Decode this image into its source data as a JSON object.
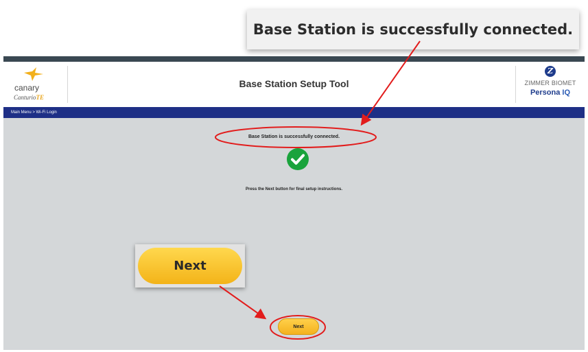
{
  "callout": {
    "text": "Base Station is successfully connected."
  },
  "header": {
    "canary_logo": "canary",
    "canturio_logo": "Canturio",
    "canturio_tc": "TE",
    "title": "Base Station Setup Tool",
    "zimmer_logo": "ZIMMER BIOMET",
    "persona_logo": "Persona",
    "persona_iq": "IQ"
  },
  "breadcrumb": "Main Menu > Wi-Fi Login",
  "main": {
    "success_message": "Base Station is successfully connected.",
    "instruction": "Press the Next button for final setup instructions.",
    "next_label": "Next"
  },
  "next_callout": {
    "label": "Next"
  },
  "colors": {
    "accent_yellow": "#f4b21e",
    "nav_blue": "#1e2f86",
    "annotation_red": "#e21c1c",
    "success_green": "#1aa33c"
  },
  "icons": {
    "success": "check-circle-icon",
    "brand": "canary-bird-icon",
    "zimmer": "zimmer-z-icon"
  }
}
